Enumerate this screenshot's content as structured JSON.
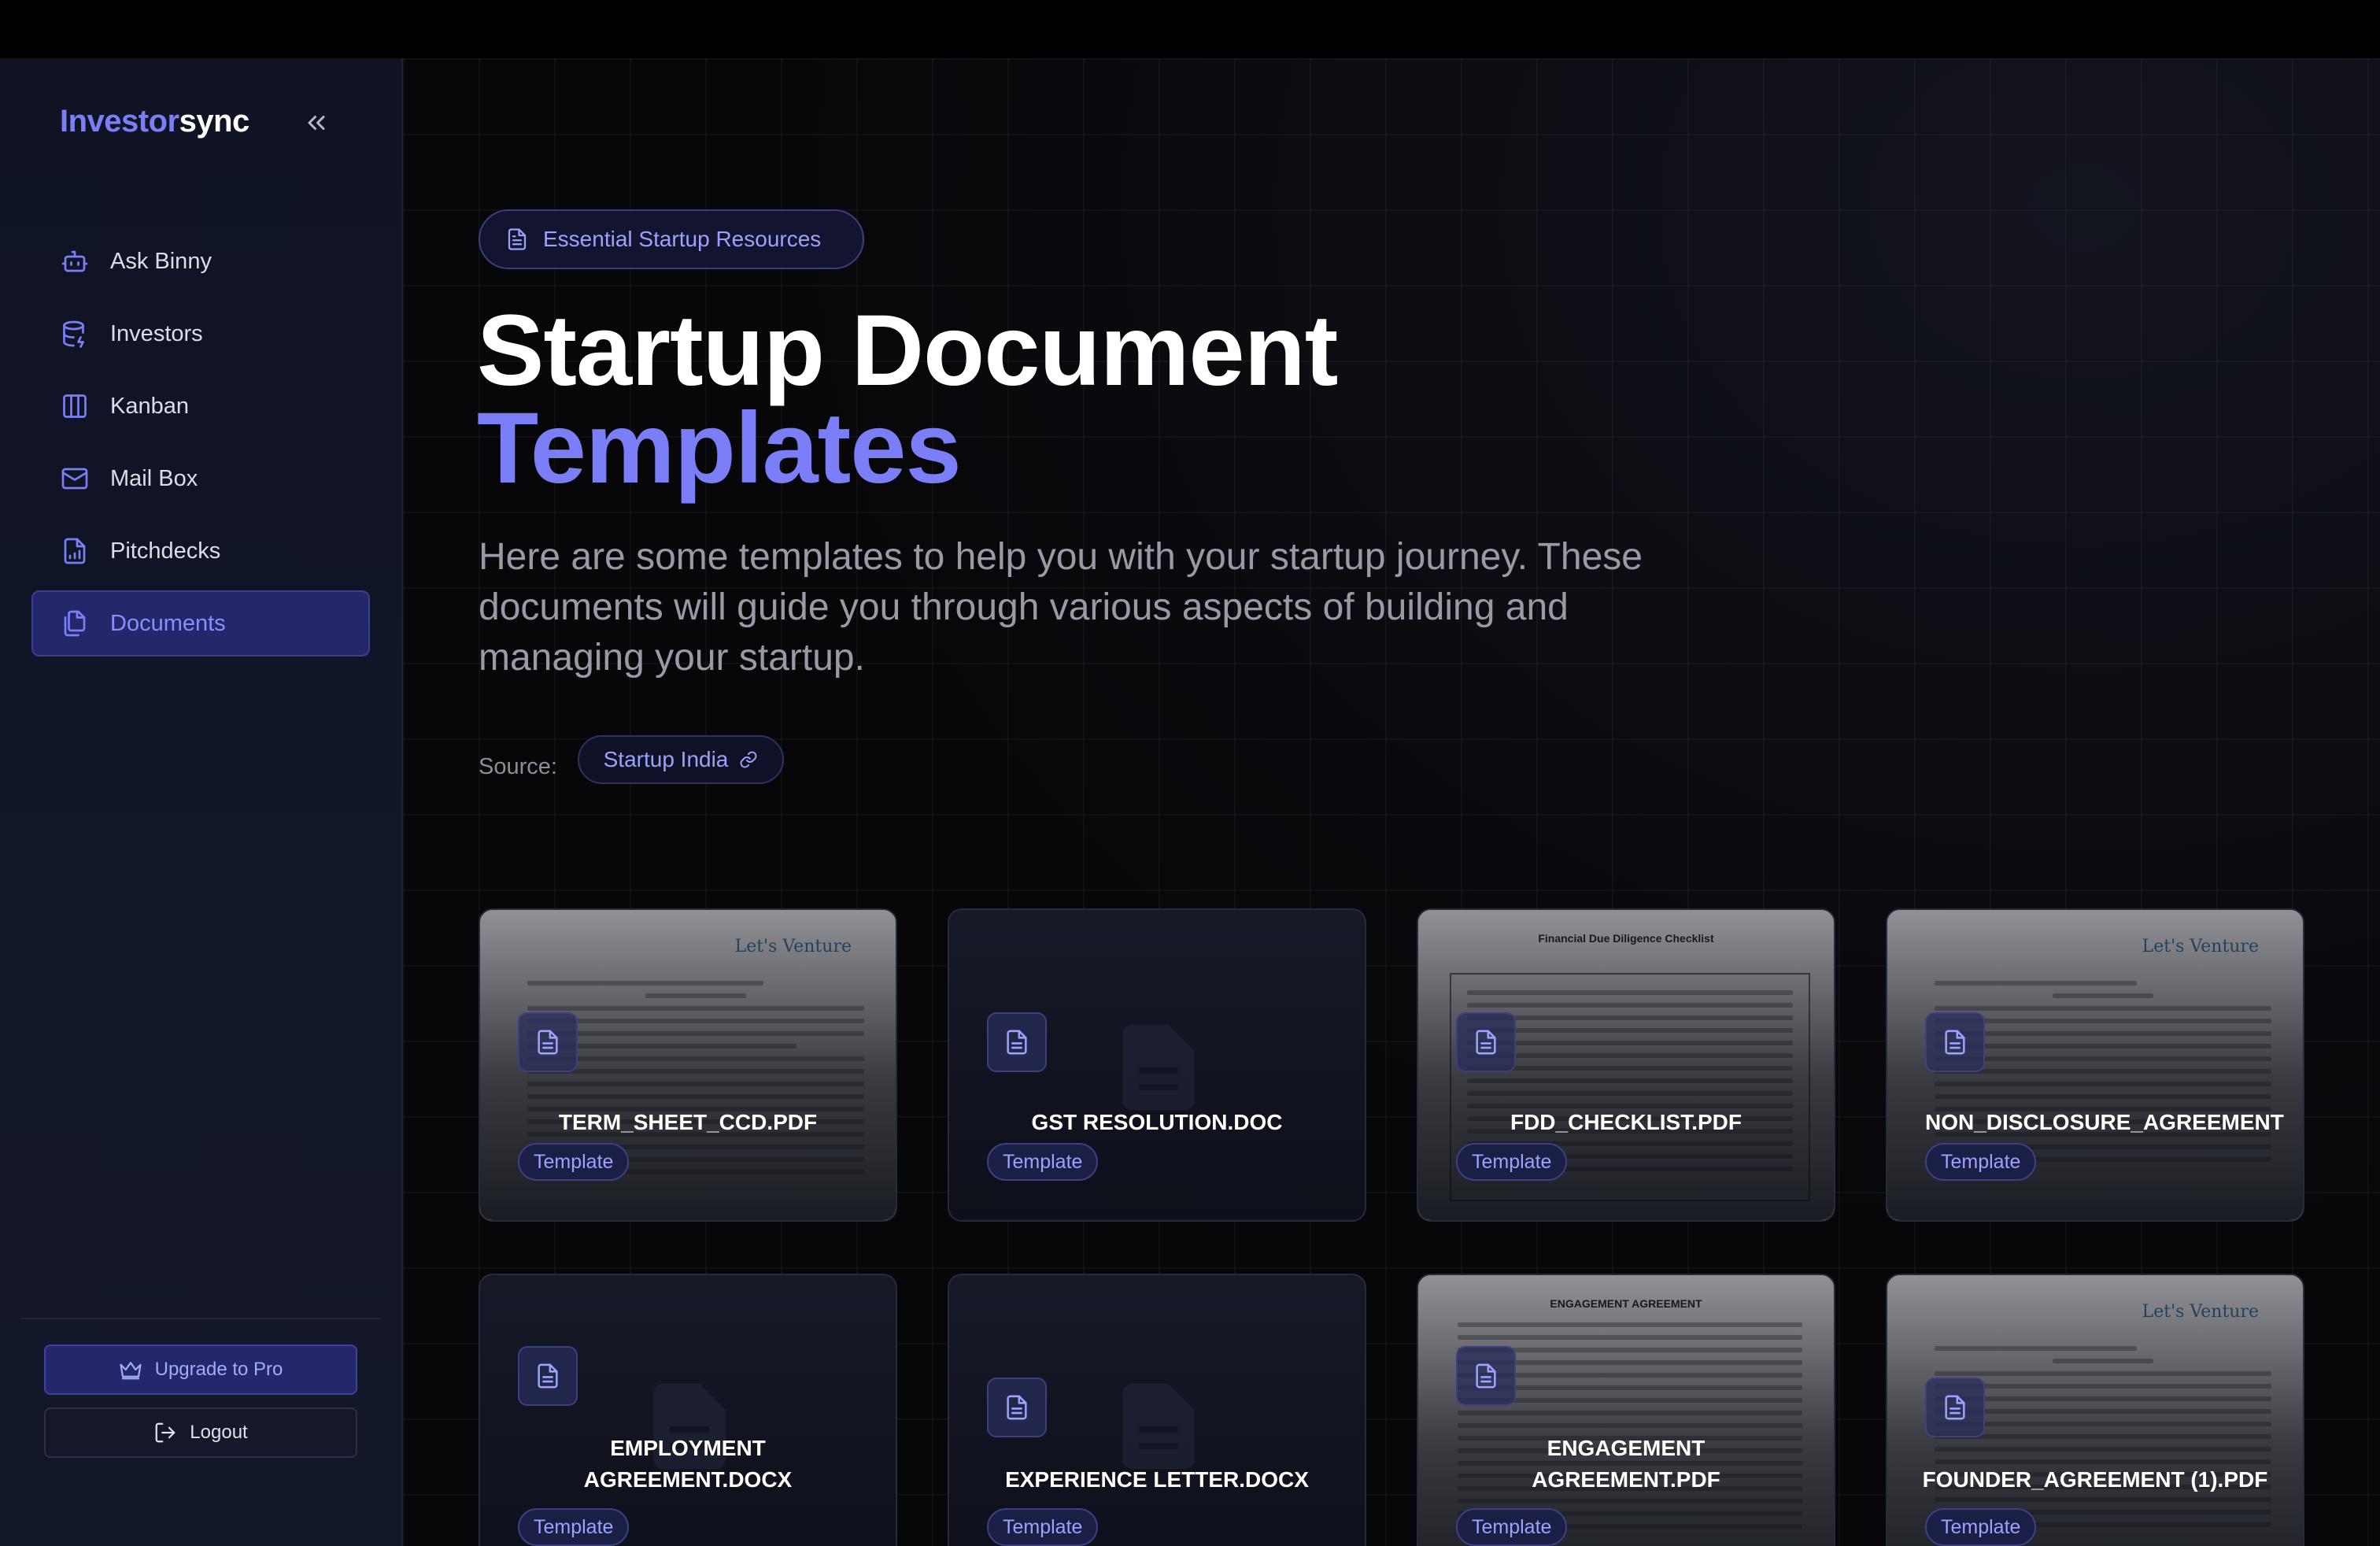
{
  "sidebar": {
    "brand_part1": "Investor",
    "brand_part2": "sync",
    "items": [
      {
        "label": "Ask Binny",
        "icon": "bot-icon"
      },
      {
        "label": "Investors",
        "icon": "database-icon"
      },
      {
        "label": "Kanban",
        "icon": "kanban-icon"
      },
      {
        "label": "Mail Box",
        "icon": "mail-icon"
      },
      {
        "label": "Pitchdecks",
        "icon": "chart-file-icon"
      },
      {
        "label": "Documents",
        "icon": "files-icon",
        "active": true
      }
    ],
    "upgrade_label": "Upgrade to Pro",
    "logout_label": "Logout"
  },
  "main": {
    "pill_label": "Essential Startup Resources",
    "title_line1": "Startup Document",
    "title_line2": "Templates",
    "subtitle": "Here are some templates to help you with your startup journey. These documents will guide you through various aspects of building and managing your startup.",
    "source_label": "Source:",
    "source_link": "Startup India"
  },
  "cards": [
    {
      "name": "TERM_SHEET_CCD.PDF",
      "tag": "Template",
      "preview": true
    },
    {
      "name": "GST RESOLUTION.DOC",
      "tag": "Template",
      "preview": false
    },
    {
      "name": "FDD_CHECKLIST.PDF",
      "tag": "Template",
      "preview": true
    },
    {
      "name": "NON_DISCLOSURE_AGREEMENT",
      "tag": "Template",
      "preview": true
    },
    {
      "name": "EMPLOYMENT AGREEMENT.DOCX",
      "tag": "Template",
      "preview": false
    },
    {
      "name": "EXPERIENCE LETTER.DOCX",
      "tag": "Template",
      "preview": false
    },
    {
      "name": "ENGAGEMENT AGREEMENT.PDF",
      "tag": "Template",
      "preview": true
    },
    {
      "name": "FOUNDER_AGREEMENT (1).PDF",
      "tag": "Template",
      "preview": true
    }
  ],
  "colors": {
    "accent": "#7b7ff7",
    "sidebar_bg": "#0f1324",
    "active_bg": "#24286a",
    "page_bg": "#070709"
  }
}
